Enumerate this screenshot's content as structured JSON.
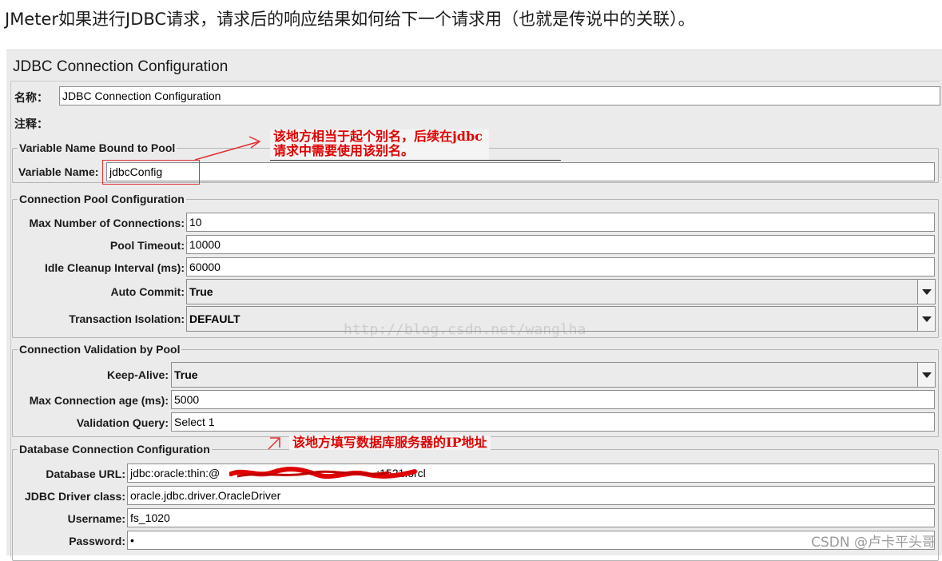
{
  "heading": "JMeter如果进行JDBC请求，请求后的响应结果如何给下一个请求用（也就是传说中的关联）。",
  "panel_title": "JDBC Connection Configuration",
  "name": {
    "label": "名称：",
    "value": "JDBC Connection Configuration"
  },
  "comment": {
    "label": "注释："
  },
  "variable_group": {
    "title": "Variable Name Bound to Pool",
    "variable_name": {
      "label": "Variable Name:",
      "value": "jdbcConfig"
    }
  },
  "pool_group": {
    "title": "Connection Pool Configuration",
    "max_connections": {
      "label": "Max Number of Connections:",
      "value": "10"
    },
    "pool_timeout": {
      "label": "Pool Timeout:",
      "value": "10000"
    },
    "idle_cleanup": {
      "label": "Idle Cleanup Interval (ms):",
      "value": "60000"
    },
    "auto_commit": {
      "label": "Auto Commit:",
      "value": "True"
    },
    "transaction_isolation": {
      "label": "Transaction Isolation:",
      "value": "DEFAULT"
    }
  },
  "validation_group": {
    "title": "Connection Validation by Pool",
    "keep_alive": {
      "label": "Keep-Alive:",
      "value": "True"
    },
    "max_age": {
      "label": "Max Connection age (ms):",
      "value": "5000"
    },
    "validation_query": {
      "label": "Validation Query:",
      "value": "Select 1"
    }
  },
  "db_group": {
    "title": "Database Connection Configuration",
    "database_url": {
      "label": "Database URL:",
      "value_prefix": "jdbc:oracle:thin:@",
      "value_suffix": ":1521:orcl"
    },
    "driver_class": {
      "label": "JDBC Driver class:",
      "value": "oracle.jdbc.driver.OracleDriver"
    },
    "username": {
      "label": "Username:",
      "value": "fs_1020"
    },
    "password": {
      "label": "Password:",
      "value": "•"
    }
  },
  "annotations": {
    "alias_line1": "该地方相当于起个别名，后续在jdbc",
    "alias_line2": "请求中需要使用该别名。",
    "ip_note": "该地方填写数据库服务器的IP地址"
  },
  "watermark": "http://blog.csdn.net/wanglha",
  "credit": "CSDN @卢卡平头哥",
  "colors": {
    "annotation_red": "#e00000",
    "panel_bg": "#ebebeb"
  }
}
